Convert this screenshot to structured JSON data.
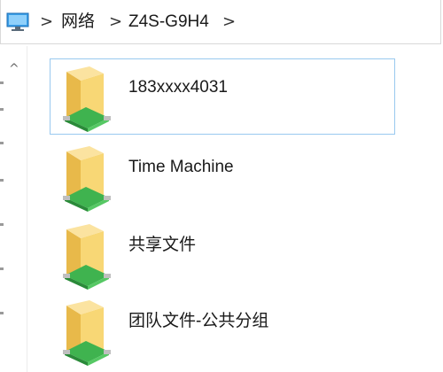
{
  "breadcrumb": {
    "root_icon": "this-pc-icon",
    "separator": ">",
    "segments": [
      "网络",
      "Z4S-G9H4"
    ]
  },
  "nav": {
    "expand_chevron": "^"
  },
  "items": [
    {
      "label": "183xxxx4031",
      "icon": "network-share-folder-icon",
      "selected": true
    },
    {
      "label": "Time Machine",
      "icon": "network-share-folder-icon",
      "selected": false
    },
    {
      "label": "共享文件",
      "icon": "network-share-folder-icon",
      "selected": false
    },
    {
      "label": "团队文件-公共分组",
      "icon": "network-share-folder-icon",
      "selected": false
    }
  ],
  "colors": {
    "selection_border": "#99c9ef",
    "folder_yellow": "#f8d775",
    "network_green": "#3fb34f"
  }
}
